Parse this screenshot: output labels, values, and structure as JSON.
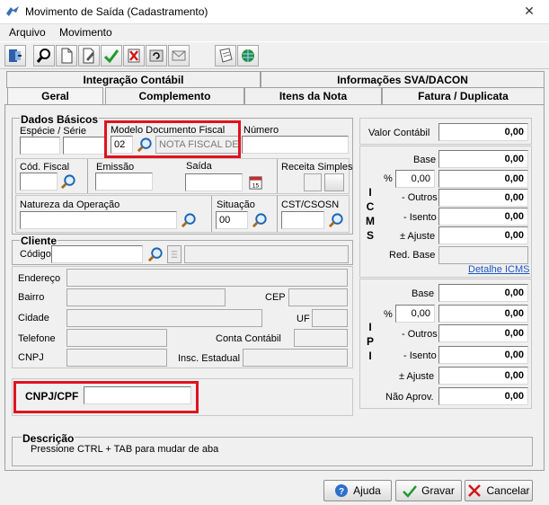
{
  "window": {
    "title": "Movimento de Saída (Cadastramento)"
  },
  "menu": [
    {
      "label": "Arquivo"
    },
    {
      "label": "Movimento"
    }
  ],
  "tabs_row1": [
    {
      "label": "Integração Contábil"
    },
    {
      "label": "Informações SVA/DACON"
    }
  ],
  "tabs_row2": [
    {
      "label": "Geral"
    },
    {
      "label": "Complemento"
    },
    {
      "label": "Itens da Nota"
    },
    {
      "label": "Fatura / Duplicata"
    }
  ],
  "dados_basicos": {
    "title": "Dados Básicos",
    "especie_serie_label": "Espécie  /  Série",
    "modelo_label": "Modelo Documento Fiscal",
    "modelo_code": "02",
    "modelo_desc": "NOTA FISCAL DE",
    "numero_label": "Número",
    "cod_fiscal_label": "Cód. Fiscal",
    "emissao_label": "Emissão",
    "saida_label": "Saída",
    "receita_simples_label": "Receita Simples",
    "natureza_label": "Natureza da Operação",
    "situacao_label": "Situação",
    "situacao_value": "00",
    "cst_label": "CST/CSOSN"
  },
  "cliente": {
    "title": "Cliente",
    "codigo_label": "Código",
    "endereco_label": "Endereço",
    "bairro_label": "Bairro",
    "cep_label": "CEP",
    "cidade_label": "Cidade",
    "uf_label": "UF",
    "telefone_label": "Telefone",
    "conta_contabil_label": "Conta Contábil",
    "cnpj_label": "CNPJ",
    "insc_estadual_label": "Insc. Estadual"
  },
  "cnpj_cpf": {
    "label": "CNPJ/CPF",
    "value": ""
  },
  "valor_contabil": {
    "label": "Valor Contábil",
    "value": "0,00"
  },
  "icms": {
    "vertical": [
      "I",
      "C",
      "M",
      "S"
    ],
    "base_label": "Base",
    "base_value": "0,00",
    "pct_label": "%",
    "pct_value": "0,00",
    "pct_amount": "0,00",
    "outros_label": "- Outros",
    "outros_value": "0,00",
    "isento_label": "- Isento",
    "isento_value": "0,00",
    "ajuste_label": "± Ajuste",
    "ajuste_value": "0,00",
    "red_base_label": "Red. Base",
    "detalhe_link": "Detalhe ICMS"
  },
  "ipi": {
    "vertical": [
      "I",
      "P",
      "I"
    ],
    "base_label": "Base",
    "base_value": "0,00",
    "pct_label": "%",
    "pct_value": "0,00",
    "pct_amount": "0,00",
    "outros_label": "- Outros",
    "outros_value": "0,00",
    "isento_label": "- Isento",
    "isento_value": "0,00",
    "ajuste_label": "± Ajuste",
    "ajuste_value": "0,00",
    "nao_aprov_label": "Não Aprov.",
    "nao_aprov_value": "0,00"
  },
  "descricao": {
    "title": "Descrição",
    "text": "Pressione CTRL + TAB para  mudar de aba"
  },
  "buttons": {
    "ajuda": "Ajuda",
    "gravar": "Gravar",
    "cancelar": "Cancelar"
  },
  "colors": {
    "highlight": "#e1121f",
    "link": "#1a56c7"
  }
}
